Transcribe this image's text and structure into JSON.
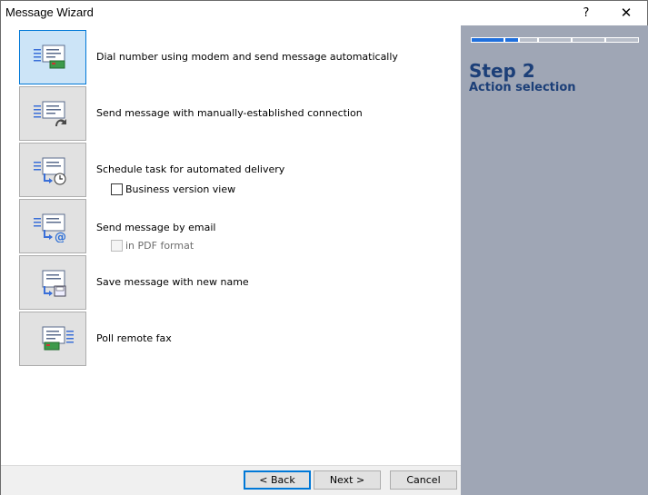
{
  "window": {
    "title": "Message Wizard",
    "help_glyph": "?",
    "close_glyph": "✕"
  },
  "actions": [
    {
      "label": "Dial number using modem and send message automatically",
      "icon": "modem-dial-icon",
      "selected": true
    },
    {
      "label": "Send message with manually-established connection",
      "icon": "manual-connection-icon",
      "selected": false
    },
    {
      "label": "Schedule task for automated delivery",
      "icon": "schedule-clock-icon",
      "selected": false
    },
    {
      "label": "Send message by email",
      "icon": "email-at-icon",
      "selected": false
    },
    {
      "label": "Save message with new name",
      "icon": "save-document-icon",
      "selected": false
    },
    {
      "label": "Poll remote fax",
      "icon": "poll-fax-icon",
      "selected": false
    }
  ],
  "options": {
    "business_version": {
      "label": "Business version view",
      "checked": false,
      "enabled": true
    },
    "pdf_format": {
      "label": "in PDF format",
      "checked": false,
      "enabled": false
    }
  },
  "buttons": {
    "back": "< Back",
    "next": "Next >",
    "cancel": "Cancel"
  },
  "side": {
    "step_title": "Step 2",
    "step_subtitle": "Action selection",
    "progress": {
      "total_steps": 6,
      "completed": 1.5
    }
  },
  "colors": {
    "side_background": "#9fa6b5",
    "step_text": "#1c3f78",
    "progress_done": "#1f6fdc",
    "selected_tile": "#cce4f7",
    "accent": "#0078d7"
  }
}
